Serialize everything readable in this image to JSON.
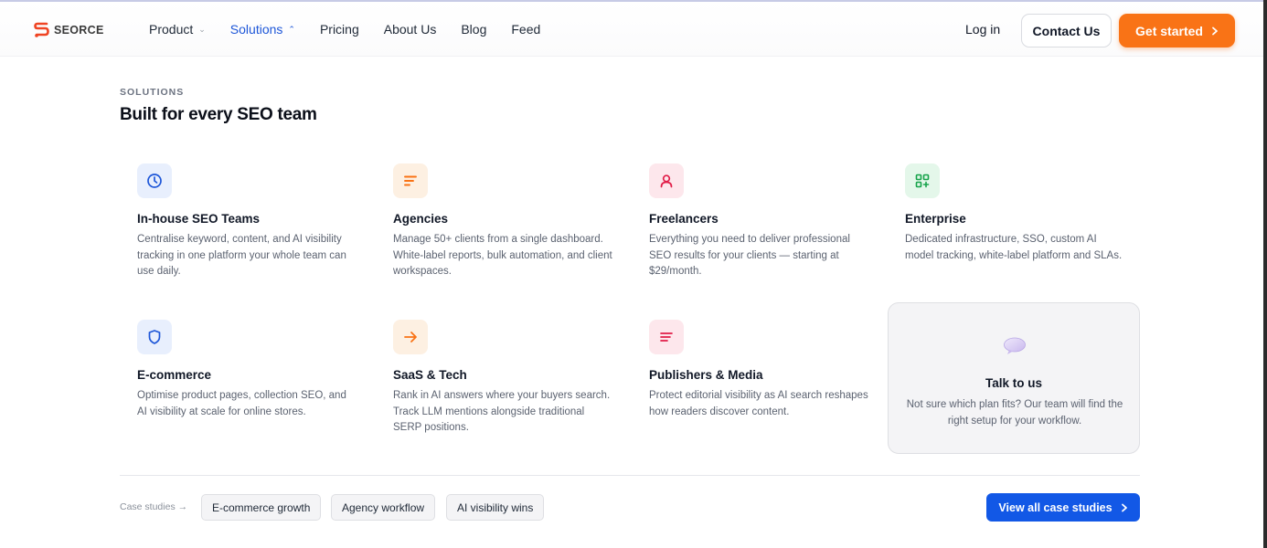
{
  "brand": {
    "name": "SEORCE",
    "accent": "#f97316",
    "link": "#1d56d8"
  },
  "nav": {
    "items": [
      {
        "label": "Product",
        "has_dropdown": true,
        "active": false
      },
      {
        "label": "Solutions",
        "has_dropdown": true,
        "active": true
      },
      {
        "label": "Pricing"
      },
      {
        "label": "About Us"
      },
      {
        "label": "Blog"
      },
      {
        "label": "Feed"
      }
    ],
    "login": "Log in",
    "contact": "Contact Us",
    "cta": "Get started"
  },
  "section": {
    "eyebrow": "SOLUTIONS",
    "title": "Built for every SEO team"
  },
  "cards": [
    {
      "icon": "clock-icon",
      "color": "#1d56d8",
      "bg": "#e8effd",
      "title": "In-house SEO Teams",
      "desc": "Centralise keyword, content, and AI visibility tracking in one platform your whole team can use daily."
    },
    {
      "icon": "list-icon",
      "color": "#f97316",
      "bg": "#fdf0e2",
      "title": "Agencies",
      "desc": "Manage 50+ clients from a single dashboard. White-label reports, bulk automation, and client workspaces."
    },
    {
      "icon": "user-icon",
      "color": "#e11d48",
      "bg": "#fde7ec",
      "title": "Freelancers",
      "desc": "Everything you need to deliver professional SEO results for your clients — starting at $29/month."
    },
    {
      "icon": "grid-plus-icon",
      "color": "#16a34a",
      "bg": "#e4f7ea",
      "title": "Enterprise",
      "desc": "Dedicated infrastructure, SSO, custom AI model tracking, white-label platform and SLAs."
    },
    {
      "icon": "shield-icon",
      "color": "#1d56d8",
      "bg": "#e8effd",
      "title": "E-commerce",
      "desc": "Optimise product pages, collection SEO, and AI visibility at scale for online stores."
    },
    {
      "icon": "arrow-right-icon",
      "color": "#f97316",
      "bg": "#fdf0e2",
      "title": "SaaS & Tech",
      "desc": "Rank in AI answers where your buyers search. Track LLM mentions alongside traditional SERP positions."
    },
    {
      "icon": "text-lines-icon",
      "color": "#e11d48",
      "bg": "#fde7ec",
      "title": "Publishers & Media",
      "desc": "Protect editorial visibility as AI search reshapes how readers discover content."
    }
  ],
  "talk": {
    "icon": "speech-bubble-icon",
    "title": "Talk to us",
    "desc": "Not sure which plan fits? Our team will find the right setup for your workflow."
  },
  "case_studies": {
    "label": "Case studies →",
    "chips": [
      "E-commerce growth",
      "Agency workflow",
      "AI visibility wins"
    ],
    "view_all": "View all case studies"
  }
}
